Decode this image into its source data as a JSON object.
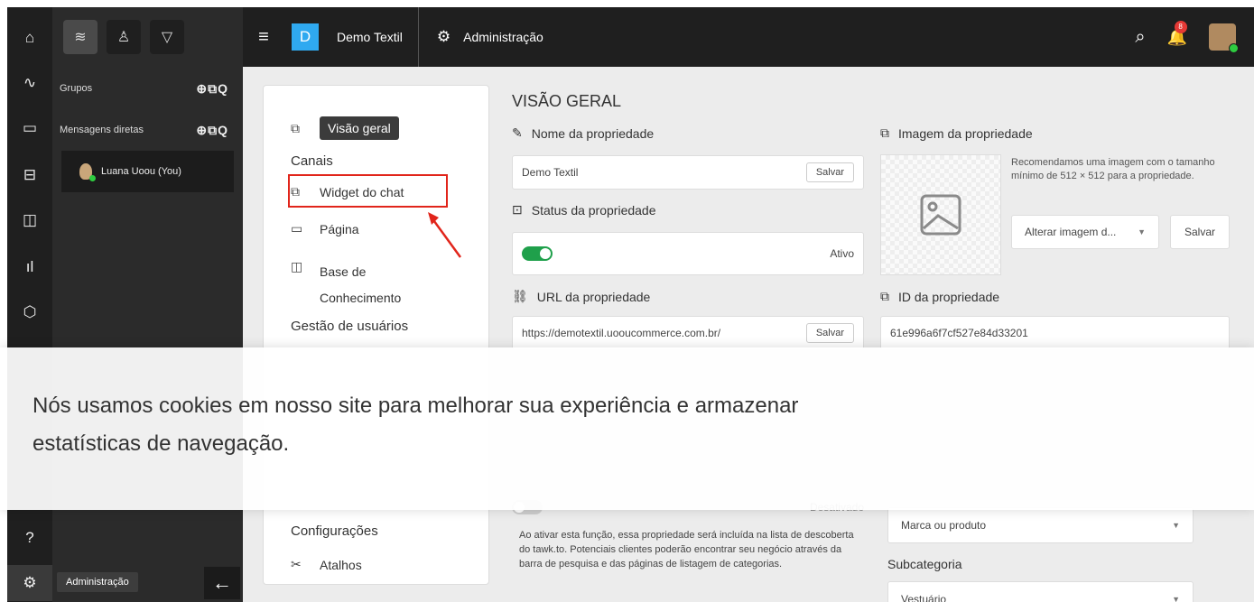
{
  "topbar": {
    "brand_letter": "D",
    "brand_name": "Demo Textil",
    "section": "Administração",
    "notification_count": "8"
  },
  "sidebar": {
    "groups_label": "Grupos",
    "direct_label": "Mensagens diretas",
    "user_name": "Luana Uoou (You)",
    "tooltip": "Administração"
  },
  "settings_nav": {
    "overview": "Visão geral",
    "channels_heading": "Canais",
    "chat_widget": "Widget do chat",
    "page": "Página",
    "kb_line1": "Base de",
    "kb_line2": "Conhecimento",
    "users_heading": "Gestão de usuários",
    "config_heading": "Configurações",
    "shortcuts": "Atalhos"
  },
  "overview": {
    "title": "VISÃO GERAL",
    "name_label": "Nome da propriedade",
    "name_value": "Demo Textil",
    "save": "Salvar",
    "status_label": "Status da propriedade",
    "status_value": "Ativo",
    "url_label": "URL da propriedade",
    "url_value": "https://demotextil.uooucommerce.com.br/",
    "image_label": "Imagem da propriedade",
    "image_hint": "Recomendamos uma imagem com o tamanho mínimo de 512 × 512 para a propriedade.",
    "image_select": "Alterar imagem d...",
    "id_label": "ID da propriedade",
    "id_value": "61e996a6f7cf527e84d33201",
    "discovery_status": "Desativado",
    "discovery_desc": "Ao ativar esta função, essa propriedade será incluída na lista de descoberta do tawk.to. Potenciais clientes poderão encontrar seu negócio através da barra de pesquisa e das páginas de listagem de categorias.",
    "category_value": "Marca ou produto",
    "subcategory_label": "Subcategoria",
    "subcategory_value": "Vestuário"
  },
  "cookie": {
    "text": "Nós usamos cookies em nosso site para melhorar sua experiência e armazenar estatísticas de navegação."
  }
}
